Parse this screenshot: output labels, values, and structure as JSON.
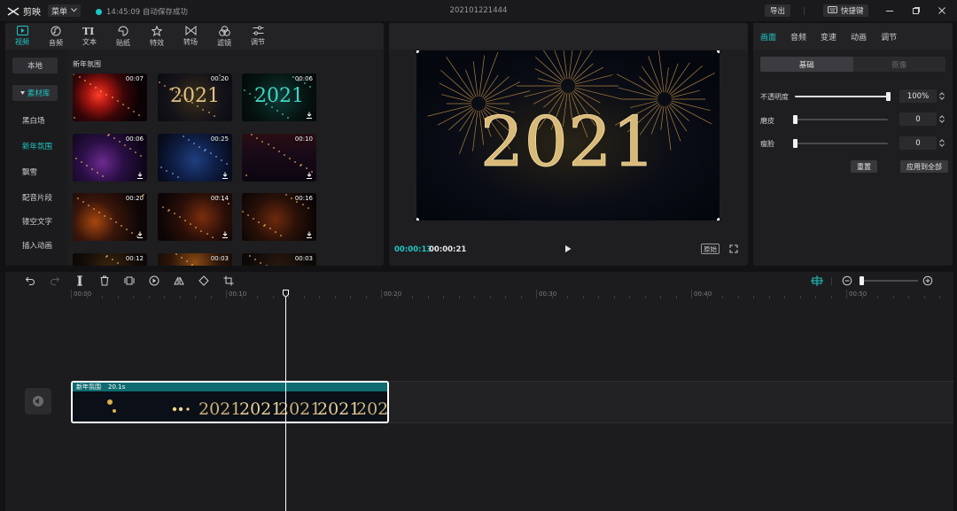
{
  "app": {
    "name": "剪映",
    "menu_label": "菜单"
  },
  "status": {
    "save_text": "14:45:09 自动保存成功"
  },
  "project": {
    "name": "202101221444"
  },
  "header_buttons": {
    "export": "导出",
    "shortcuts": "快捷键"
  },
  "media": {
    "tabs": [
      {
        "label": "视频",
        "icon": "video-icon",
        "active": true
      },
      {
        "label": "音频",
        "icon": "audio-icon"
      },
      {
        "label": "文本",
        "icon": "text-icon"
      },
      {
        "label": "贴纸",
        "icon": "sticker-icon"
      },
      {
        "label": "特效",
        "icon": "effects-icon"
      },
      {
        "label": "转场",
        "icon": "transition-icon"
      },
      {
        "label": "滤镜",
        "icon": "filter-icon"
      },
      {
        "label": "调节",
        "icon": "adjust-icon"
      }
    ],
    "sidebar": [
      {
        "label": "本地"
      },
      {
        "label": "素材库",
        "active": true
      },
      {
        "label": "黑白场"
      },
      {
        "label": "新年氛围",
        "active": true
      },
      {
        "label": "飘雪"
      },
      {
        "label": "配音片段"
      },
      {
        "label": "镂空文字"
      },
      {
        "label": "插入动画"
      }
    ],
    "section_title": "新年氛围",
    "thumbnails": [
      {
        "duration": "00:07",
        "style": "red-fireworks",
        "downloaded": true
      },
      {
        "duration": "00:20",
        "style": "gold-2021",
        "downloaded": true
      },
      {
        "duration": "00:06",
        "style": "teal-2021",
        "downloaded": false
      },
      {
        "duration": "00:06",
        "style": "purple-sparkle",
        "downloaded": false
      },
      {
        "duration": "00:25",
        "style": "blue-glitter",
        "downloaded": false
      },
      {
        "duration": "00:10",
        "style": "rain-fireworks",
        "downloaded": false
      },
      {
        "duration": "00:20",
        "style": "bokeh-orange",
        "downloaded": false
      },
      {
        "duration": "00:14",
        "style": "ember-sparks",
        "downloaded": false
      },
      {
        "duration": "00:16",
        "style": "ember-sparks-2",
        "downloaded": false
      },
      {
        "duration": "00:12",
        "style": "dark-sparks",
        "downloaded": true
      },
      {
        "duration": "00:03",
        "style": "warm-glow",
        "downloaded": true
      },
      {
        "duration": "00:03",
        "style": "dark-dots",
        "downloaded": true
      }
    ],
    "thumb_text": "2021"
  },
  "preview": {
    "frame_text": "2021",
    "current_time": "00:00:13",
    "total_time": "00:00:21",
    "ratio_label": "原始"
  },
  "inspector": {
    "tabs": [
      {
        "label": "画面",
        "active": true
      },
      {
        "label": "音频"
      },
      {
        "label": "变速"
      },
      {
        "label": "动画"
      },
      {
        "label": "调节"
      }
    ],
    "segments": [
      {
        "label": "基础",
        "active": true
      },
      {
        "label": "抠像"
      }
    ],
    "params": [
      {
        "label": "不透明度",
        "value": "100%",
        "level": 1.0
      },
      {
        "label": "磨皮",
        "value": "0",
        "level": 0.0
      },
      {
        "label": "瘦脸",
        "value": "0",
        "level": 0.0
      }
    ],
    "reset_label": "重置",
    "apply_all_label": "应用到全部"
  },
  "timeline": {
    "ruler": [
      "00:00",
      "00:10",
      "00:20",
      "00:30",
      "00:40",
      "00:50"
    ],
    "clip": {
      "name": "新年氛围",
      "duration": "20.1s",
      "frame_text": "2021"
    },
    "playhead_seconds": 13,
    "zoom_level": 0.03
  }
}
